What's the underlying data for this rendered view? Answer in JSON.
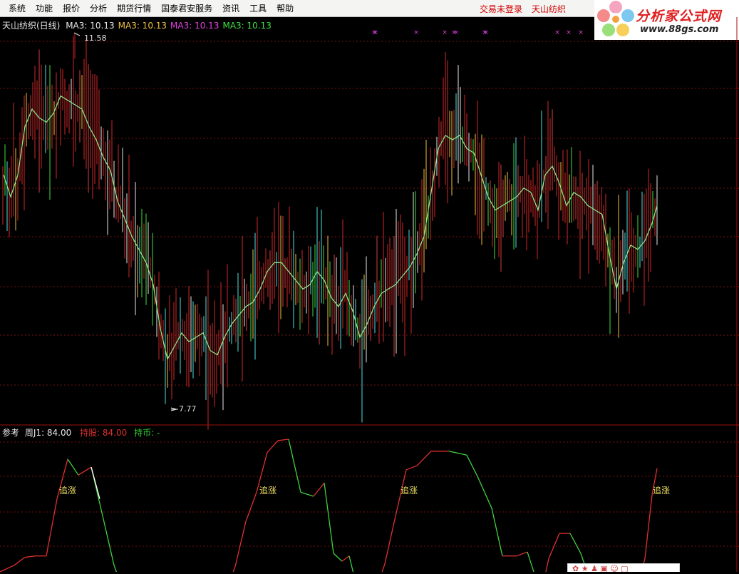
{
  "menu": {
    "items": [
      "系统",
      "功能",
      "报价",
      "分析",
      "期货行情",
      "国泰君安服务",
      "资讯",
      "工具",
      "帮助"
    ],
    "status_login": "交易未登录",
    "stock_name": "天山纺织"
  },
  "logo": {
    "brand": "分析家公式网",
    "site": "www.88gs.com"
  },
  "main_legend": {
    "title": "天山纺织(日线)",
    "ma_items": [
      {
        "label": "MA3: 10.13",
        "color": "#e8e8e8"
      },
      {
        "label": "MA3: 10.13",
        "color": "#f0c040"
      },
      {
        "label": "MA3: 10.13",
        "color": "#e040e0"
      },
      {
        "label": "MA3: 10.13",
        "color": "#40e040"
      }
    ],
    "high_label": "11.58",
    "low_label": "7.77"
  },
  "sub_legend": {
    "name": "参考",
    "j1": "周J1: 84.00",
    "hold": "持股: 84.00",
    "cash": "持币: -"
  },
  "signal_label": "追涨",
  "chart_data": {
    "type": "candlestick_with_indicator",
    "main": {
      "ylim": [
        7.5,
        12.0
      ],
      "high": 11.58,
      "low": 7.77,
      "ma_path": [
        [
          5,
          10.3
        ],
        [
          15,
          10.05
        ],
        [
          25,
          10.3
        ],
        [
          35,
          10.85
        ],
        [
          45,
          11.05
        ],
        [
          55,
          10.95
        ],
        [
          65,
          10.9
        ],
        [
          75,
          11.0
        ],
        [
          85,
          11.2
        ],
        [
          95,
          11.15
        ],
        [
          105,
          11.1
        ],
        [
          115,
          11.05
        ],
        [
          125,
          10.85
        ],
        [
          135,
          10.7
        ],
        [
          145,
          10.5
        ],
        [
          155,
          10.35
        ],
        [
          165,
          10.0
        ],
        [
          175,
          9.8
        ],
        [
          185,
          9.6
        ],
        [
          195,
          9.45
        ],
        [
          205,
          9.3
        ],
        [
          215,
          9.05
        ],
        [
          225,
          8.55
        ],
        [
          235,
          8.2
        ],
        [
          245,
          8.35
        ],
        [
          255,
          8.5
        ],
        [
          265,
          8.4
        ],
        [
          275,
          8.45
        ],
        [
          285,
          8.5
        ],
        [
          295,
          8.3
        ],
        [
          305,
          8.25
        ],
        [
          315,
          8.45
        ],
        [
          325,
          8.6
        ],
        [
          335,
          8.7
        ],
        [
          345,
          8.8
        ],
        [
          355,
          8.85
        ],
        [
          365,
          9.0
        ],
        [
          375,
          9.2
        ],
        [
          385,
          9.3
        ],
        [
          395,
          9.3
        ],
        [
          405,
          9.2
        ],
        [
          415,
          9.1
        ],
        [
          425,
          9.0
        ],
        [
          435,
          9.05
        ],
        [
          445,
          9.2
        ],
        [
          455,
          9.1
        ],
        [
          465,
          8.9
        ],
        [
          475,
          8.8
        ],
        [
          485,
          8.95
        ],
        [
          495,
          8.75
        ],
        [
          505,
          8.45
        ],
        [
          515,
          8.6
        ],
        [
          525,
          8.8
        ],
        [
          535,
          8.95
        ],
        [
          545,
          9.0
        ],
        [
          555,
          9.05
        ],
        [
          565,
          9.15
        ],
        [
          575,
          9.25
        ],
        [
          585,
          9.4
        ],
        [
          595,
          9.6
        ],
        [
          605,
          10.1
        ],
        [
          615,
          10.6
        ],
        [
          625,
          10.75
        ],
        [
          635,
          10.7
        ],
        [
          645,
          10.75
        ],
        [
          655,
          10.6
        ],
        [
          665,
          10.55
        ],
        [
          675,
          10.3
        ],
        [
          685,
          10.05
        ],
        [
          695,
          9.9
        ],
        [
          705,
          9.95
        ],
        [
          715,
          10.0
        ],
        [
          725,
          10.05
        ],
        [
          735,
          10.15
        ],
        [
          745,
          10.1
        ],
        [
          755,
          9.9
        ],
        [
          765,
          10.3
        ],
        [
          775,
          10.4
        ],
        [
          785,
          10.2
        ],
        [
          795,
          9.95
        ],
        [
          805,
          10.1
        ],
        [
          815,
          10.05
        ],
        [
          825,
          9.95
        ],
        [
          835,
          9.9
        ],
        [
          845,
          9.85
        ],
        [
          855,
          9.4
        ],
        [
          865,
          9.0
        ],
        [
          875,
          9.3
        ],
        [
          885,
          9.5
        ],
        [
          895,
          9.45
        ],
        [
          905,
          9.55
        ],
        [
          915,
          9.75
        ],
        [
          922,
          9.95
        ]
      ]
    },
    "indicator": {
      "ylim": [
        0,
        100
      ],
      "signals": [
        {
          "x": 95,
          "label": "追涨"
        },
        {
          "x": 376,
          "label": "追涨"
        },
        {
          "x": 574,
          "label": "追涨"
        },
        {
          "x": 928,
          "label": "追涨"
        }
      ],
      "line": [
        [
          0,
          0
        ],
        [
          20,
          5
        ],
        [
          35,
          11
        ],
        [
          50,
          12
        ],
        [
          65,
          12
        ],
        [
          80,
          55
        ],
        [
          95,
          85
        ],
        [
          110,
          73
        ],
        [
          128,
          79
        ],
        [
          145,
          40
        ],
        [
          160,
          5
        ],
        [
          170,
          -10
        ],
        [
          320,
          -10
        ],
        [
          330,
          4
        ],
        [
          345,
          38
        ],
        [
          360,
          60
        ],
        [
          375,
          90
        ],
        [
          390,
          99
        ],
        [
          405,
          100
        ],
        [
          422,
          60
        ],
        [
          440,
          57
        ],
        [
          455,
          67
        ],
        [
          468,
          14
        ],
        [
          480,
          8
        ],
        [
          490,
          12
        ],
        [
          500,
          -10
        ],
        [
          530,
          -10
        ],
        [
          540,
          6
        ],
        [
          555,
          42
        ],
        [
          570,
          77
        ],
        [
          585,
          80
        ],
        [
          605,
          91
        ],
        [
          630,
          91
        ],
        [
          655,
          88
        ],
        [
          670,
          72
        ],
        [
          690,
          48
        ],
        [
          705,
          12
        ],
        [
          725,
          12
        ],
        [
          740,
          15
        ],
        [
          755,
          -10
        ],
        [
          762,
          -10
        ],
        [
          770,
          10
        ],
        [
          785,
          29
        ],
        [
          800,
          29
        ],
        [
          815,
          14
        ],
        [
          830,
          -10
        ],
        [
          895,
          -10
        ],
        [
          905,
          10
        ],
        [
          915,
          58
        ],
        [
          922,
          78
        ]
      ]
    }
  }
}
